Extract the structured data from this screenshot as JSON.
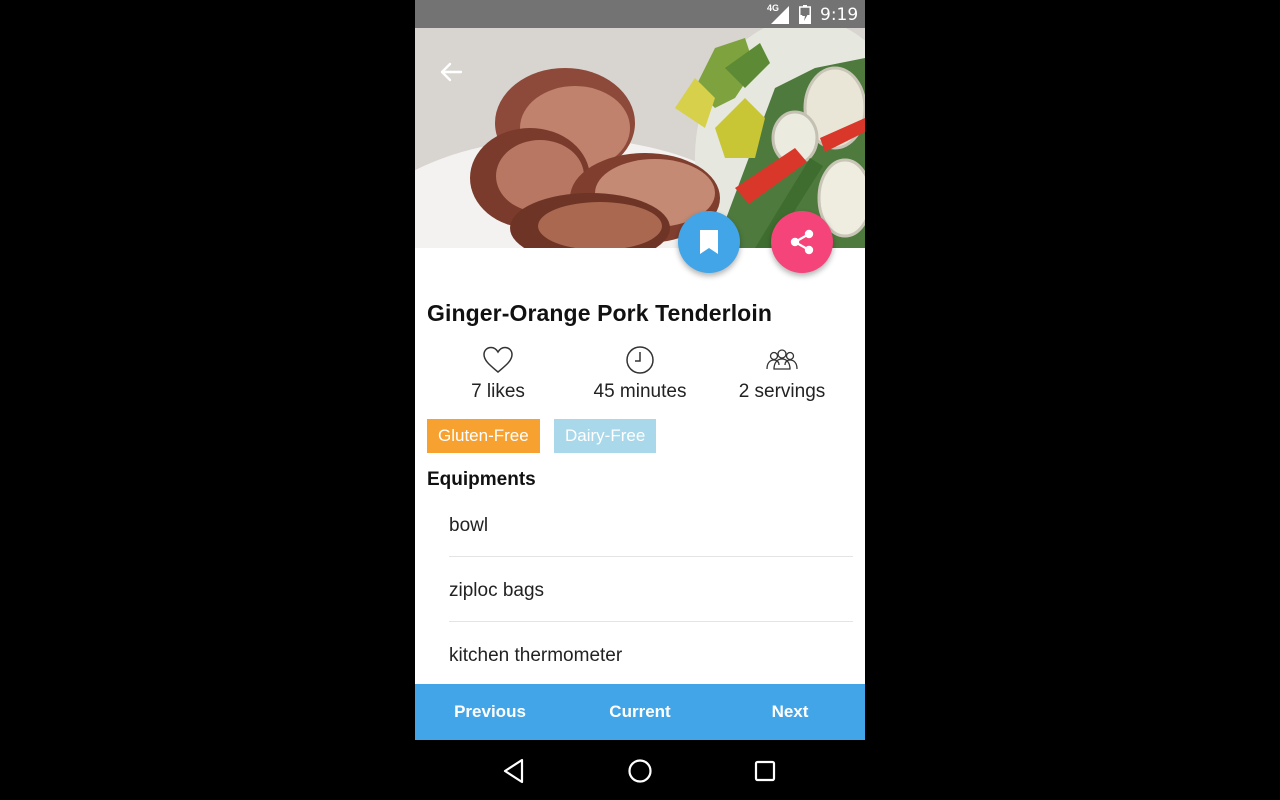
{
  "status": {
    "network": "4G",
    "time": "9:19"
  },
  "recipe": {
    "title": "Ginger-Orange Pork Tenderloin",
    "likes": "7 likes",
    "time": "45 minutes",
    "servings": "2 servings",
    "tags": [
      "Gluten-Free",
      "Dairy-Free"
    ]
  },
  "equipments": {
    "heading": "Equipments",
    "items": [
      "bowl",
      "ziploc bags",
      "kitchen thermometer"
    ]
  },
  "navigation": {
    "previous": "Previous",
    "current": "Current",
    "next": "Next"
  },
  "colors": {
    "accent_blue": "#42a5e8",
    "share_pink": "#f5447a",
    "tag_orange": "#f7a130",
    "tag_lightblue": "#a8d8ea",
    "statusbar": "#737373"
  },
  "icons": {
    "back": "arrow-left-icon",
    "bookmark": "bookmark-icon",
    "share": "share-icon",
    "likes": "heart-icon",
    "time": "clock-icon",
    "servings": "people-icon"
  }
}
